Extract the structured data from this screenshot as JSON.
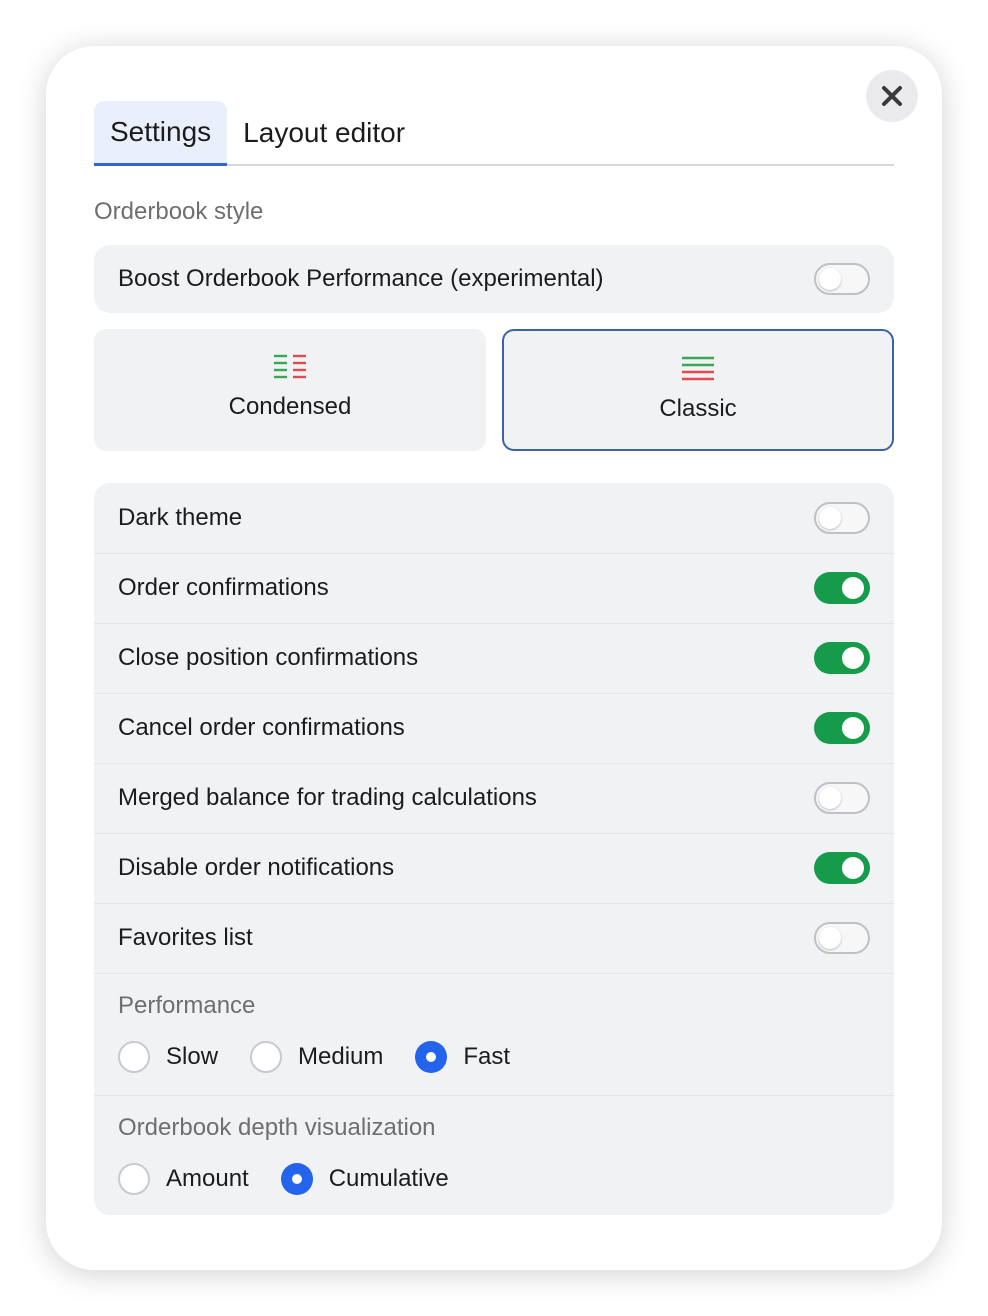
{
  "tabs": [
    {
      "label": "Settings",
      "active": true
    },
    {
      "label": "Layout editor",
      "active": false
    }
  ],
  "orderbook_style": {
    "section_label": "Orderbook style",
    "boost": {
      "label": "Boost Orderbook Performance (experimental)",
      "on": false
    },
    "options": [
      {
        "label": "Condensed",
        "icon": "condensed-orderbook-icon",
        "selected": false
      },
      {
        "label": "Classic",
        "icon": "classic-orderbook-icon",
        "selected": true
      }
    ]
  },
  "settings": [
    {
      "label": "Dark theme",
      "on": false
    },
    {
      "label": "Order confirmations",
      "on": true
    },
    {
      "label": "Close position confirmations",
      "on": true
    },
    {
      "label": "Cancel order confirmations",
      "on": true
    },
    {
      "label": "Merged balance for trading calculations",
      "on": false
    },
    {
      "label": "Disable order notifications",
      "on": true
    },
    {
      "label": "Favorites list",
      "on": false
    }
  ],
  "performance": {
    "label": "Performance",
    "options": [
      "Slow",
      "Medium",
      "Fast"
    ],
    "selected": "Fast"
  },
  "depth_visualization": {
    "label": "Orderbook depth visualization",
    "options": [
      "Amount",
      "Cumulative"
    ],
    "selected": "Cumulative"
  },
  "colors": {
    "toggle_on": "#169b4a",
    "radio_checked": "#2463eb",
    "tab_accent": "#2f66d6",
    "bid_green": "#3aa757",
    "ask_red": "#e5484d"
  },
  "close_icon": "close-icon"
}
